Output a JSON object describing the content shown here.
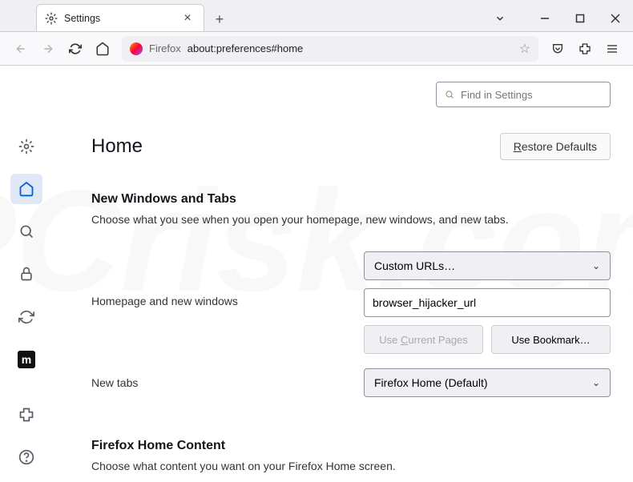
{
  "window": {
    "tab_title": "Settings"
  },
  "toolbar": {
    "address_label": "Firefox",
    "address_url": "about:preferences#home",
    "dropdown_icon": "chevron-down"
  },
  "search": {
    "placeholder": "Find in Settings"
  },
  "page": {
    "heading": "Home",
    "restore_button": "Restore Defaults"
  },
  "section_new_windows": {
    "title": "New Windows and Tabs",
    "description": "Choose what you see when you open your homepage, new windows, and new tabs.",
    "homepage_label": "Homepage and new windows",
    "homepage_select": "Custom URLs…",
    "homepage_url_value": "browser_hijacker_url",
    "use_current_button": "Use Current Pages",
    "use_bookmark_button": "Use Bookmark…",
    "newtabs_label": "New tabs",
    "newtabs_select": "Firefox Home (Default)"
  },
  "section_home_content": {
    "title": "Firefox Home Content",
    "description": "Choose what content you want on your Firefox Home screen."
  }
}
